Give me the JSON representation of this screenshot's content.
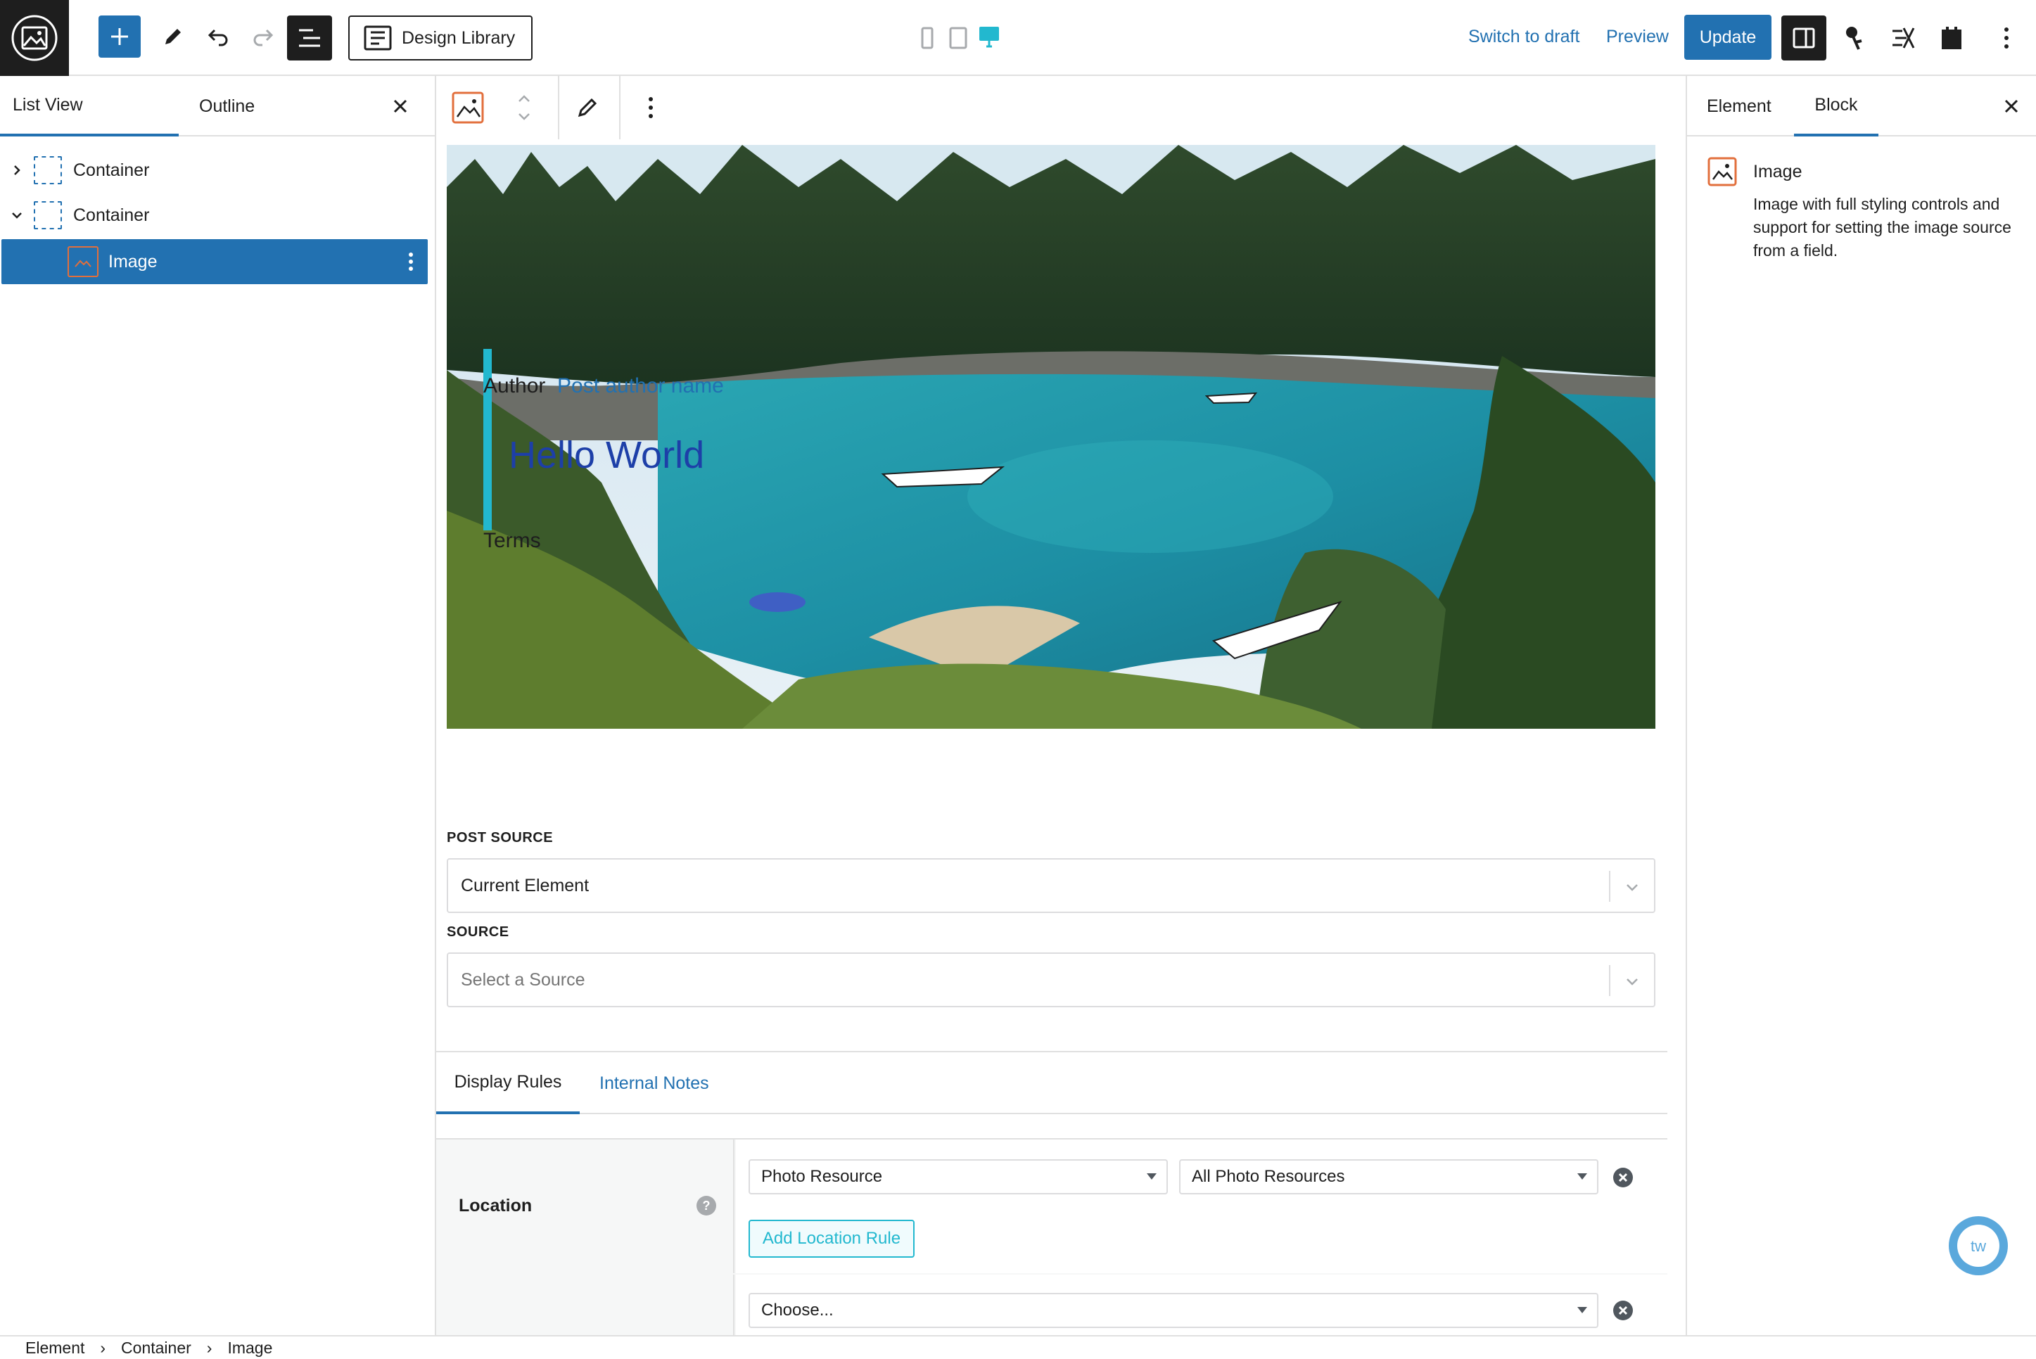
{
  "topbar": {
    "design_library_label": "Design Library",
    "switch_to_draft_label": "Switch to draft",
    "preview_label": "Preview",
    "update_label": "Update"
  },
  "left_panel": {
    "tabs": [
      "List View",
      "Outline"
    ],
    "tree": [
      {
        "label": "Container",
        "expanded": false
      },
      {
        "label": "Container",
        "expanded": true
      },
      {
        "label": "Image",
        "selected": true
      }
    ]
  },
  "hero": {
    "author_label": "Author",
    "author_link": "Post author name",
    "title": "Hello World",
    "terms": "Terms"
  },
  "fields": {
    "post_source_label": "POST SOURCE",
    "post_source_value": "Current Element",
    "source_label": "SOURCE",
    "source_placeholder": "Select a Source"
  },
  "acf": {
    "tabs": [
      "Display Rules",
      "Internal Notes"
    ],
    "location_label": "Location",
    "help": "?",
    "param_value": "Photo Resource",
    "operand_value": "All Photo Resources",
    "add_rule_label": "Add Location Rule",
    "choose_value": "Choose..."
  },
  "right_panel": {
    "tabs": [
      "Element",
      "Block"
    ],
    "block_title": "Image",
    "block_description": "Image with full styling controls and support for setting the image source from a field."
  },
  "breadcrumb": [
    "Element",
    "Container",
    "Image"
  ],
  "colors": {
    "accent": "#2271b1",
    "dark": "#1e1e1e",
    "teal": "#22b8cf",
    "orange": "#e26f3c"
  }
}
